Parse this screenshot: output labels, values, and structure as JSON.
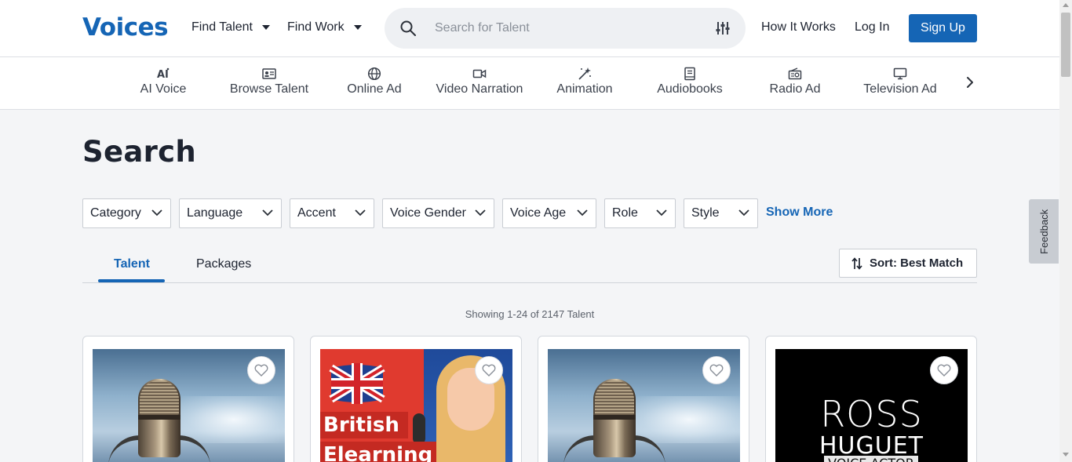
{
  "header": {
    "logo": "Voices",
    "nav": [
      {
        "label": "Find Talent"
      },
      {
        "label": "Find Work"
      }
    ],
    "search": {
      "placeholder": "Search for Talent",
      "value": ""
    },
    "how_it_works": "How It Works",
    "log_in": "Log In",
    "sign_up": "Sign Up"
  },
  "categories": [
    {
      "label": "AI Voice",
      "icon": "ai-icon"
    },
    {
      "label": "Browse Talent",
      "icon": "id-card-icon"
    },
    {
      "label": "Online Ad",
      "icon": "globe-icon"
    },
    {
      "label": "Video Narration",
      "icon": "video-camera-icon"
    },
    {
      "label": "Animation",
      "icon": "magic-wand-icon"
    },
    {
      "label": "Audiobooks",
      "icon": "book-icon"
    },
    {
      "label": "Radio Ad",
      "icon": "radio-icon"
    },
    {
      "label": "Television Ad",
      "icon": "monitor-icon"
    }
  ],
  "main": {
    "title": "Search",
    "filters": [
      {
        "label": "Category"
      },
      {
        "label": "Language"
      },
      {
        "label": "Accent"
      },
      {
        "label": "Voice Gender"
      },
      {
        "label": "Voice Age"
      },
      {
        "label": "Role"
      },
      {
        "label": "Style"
      }
    ],
    "show_more": "Show More",
    "tabs": [
      {
        "label": "Talent",
        "active": true
      },
      {
        "label": "Packages",
        "active": false
      }
    ],
    "sort_label": "Sort: Best Match",
    "showing": "Showing 1-24 of 2147 Talent"
  },
  "cards": [
    {
      "image": "studio-microphone"
    },
    {
      "image": "british-elearning",
      "overlay_line1": "British",
      "overlay_line2": "Elearning"
    },
    {
      "image": "studio-microphone"
    },
    {
      "image": "ross-huguet",
      "overlay_line1": "ROSS",
      "overlay_line2": "HUGUET",
      "overlay_line3": "VOICE ACTOR"
    }
  ],
  "feedback": "Feedback",
  "colors": {
    "brand": "#1565b5",
    "background": "#f4f5f7"
  }
}
